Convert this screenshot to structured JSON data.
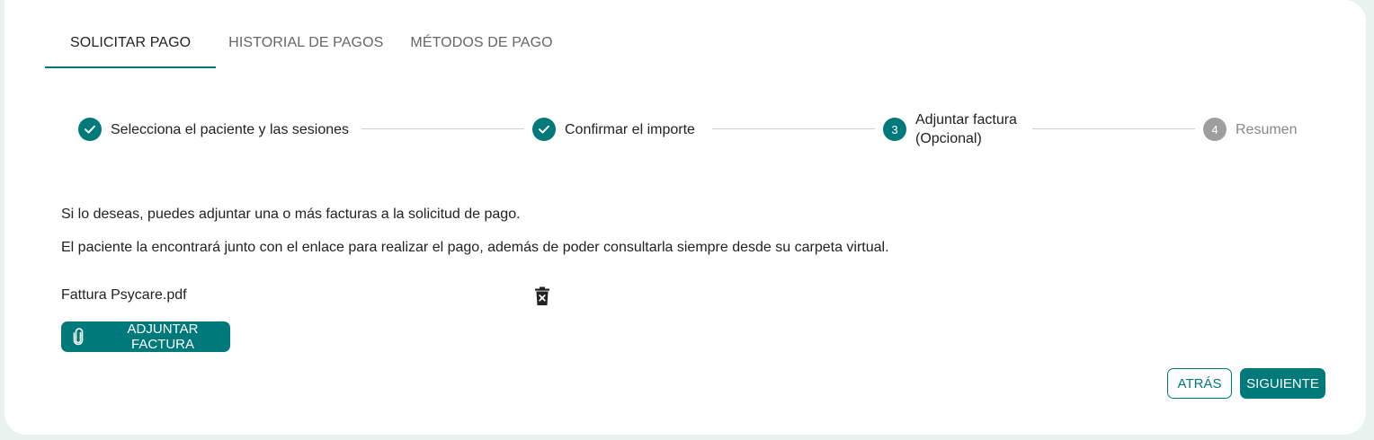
{
  "tabs": [
    {
      "label": "SOLICITAR PAGO",
      "active": true
    },
    {
      "label": "HISTORIAL DE PAGOS",
      "active": false
    },
    {
      "label": "MÉTODOS DE PAGO",
      "active": false
    }
  ],
  "stepper": {
    "steps": [
      {
        "number": "",
        "label": "Selecciona el paciente y las sesiones",
        "status": "completed",
        "icon": "check-icon"
      },
      {
        "number": "",
        "label": "Confirmar el importe",
        "status": "completed",
        "icon": "check-icon"
      },
      {
        "number": "3",
        "label_line1": "Adjuntar factura",
        "label_line2": "(Opcional)",
        "status": "active"
      },
      {
        "number": "4",
        "label": "Resumen",
        "status": "inactive"
      }
    ]
  },
  "content": {
    "intro": "Si lo deseas, puedes adjuntar una o más facturas a la solicitud de pago.",
    "info": "El paciente la encontrará junto con el enlace para realizar el pago, además de poder consultarla siempre desde su carpeta virtual.",
    "files": [
      {
        "name": "Fattura Psycare.pdf"
      }
    ],
    "attach_label": "ADJUNTAR FACTURA"
  },
  "footer": {
    "back_label": "ATRÁS",
    "next_label": "SIGUIENTE"
  },
  "colors": {
    "primary": "#00797a",
    "inactive": "#9e9e9e",
    "background": "#e8f3f0"
  }
}
